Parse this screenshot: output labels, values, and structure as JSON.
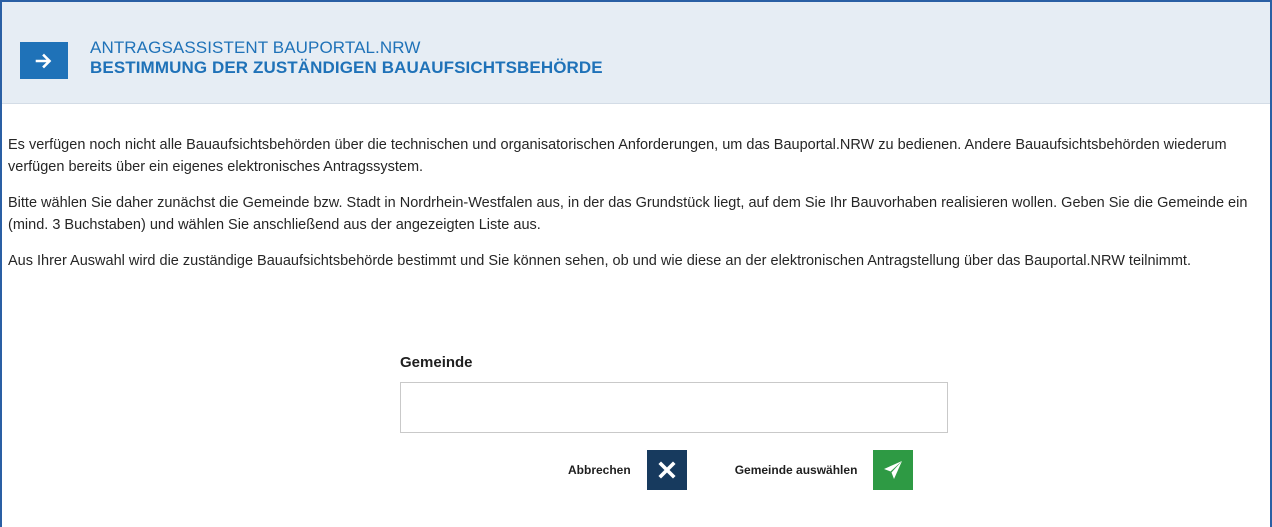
{
  "header": {
    "subtitle": "ANTRAGSASSISTENT BAUPORTAL.NRW",
    "title": "BESTIMMUNG DER ZUSTÄNDIGEN BAUAUFSICHTSBEHÖRDE",
    "icon": "arrow-right-icon"
  },
  "content": {
    "paragraph_1": "Es verfügen noch nicht alle Bauaufsichtsbehörden über die technischen und organisatorischen Anforderungen, um das Bauportal.NRW zu bedienen. Andere Bauaufsichtsbehörden wiederum verfügen bereits über ein eigenes elektronisches Antragssystem.",
    "paragraph_2": "Bitte wählen Sie daher zunächst die Gemeinde bzw. Stadt in Nordrhein-Westfalen aus, in der das Grundstück liegt, auf dem Sie Ihr Bauvorhaben realisieren wollen. Geben Sie die Gemeinde ein (mind. 3 Buchstaben) und wählen Sie anschließend aus der angezeigten Liste aus.",
    "paragraph_3": "Aus Ihrer Auswahl wird die zuständige Bauaufsichtsbehörde bestimmt und Sie können sehen, ob und wie diese an der elektronischen Antragstellung über das Bauportal.NRW teilnimmt."
  },
  "form": {
    "gemeinde_label": "Gemeinde",
    "gemeinde_value": ""
  },
  "actions": {
    "cancel_label": "Abbrechen",
    "cancel_icon": "close-icon",
    "submit_label": "Gemeinde auswählen",
    "submit_icon": "send-icon"
  },
  "colors": {
    "accent": "#1f72b8",
    "header_bg": "#e6edf4",
    "cancel_bg": "#173a5e",
    "submit_bg": "#2e9a44",
    "border": "#2a5fa4"
  }
}
